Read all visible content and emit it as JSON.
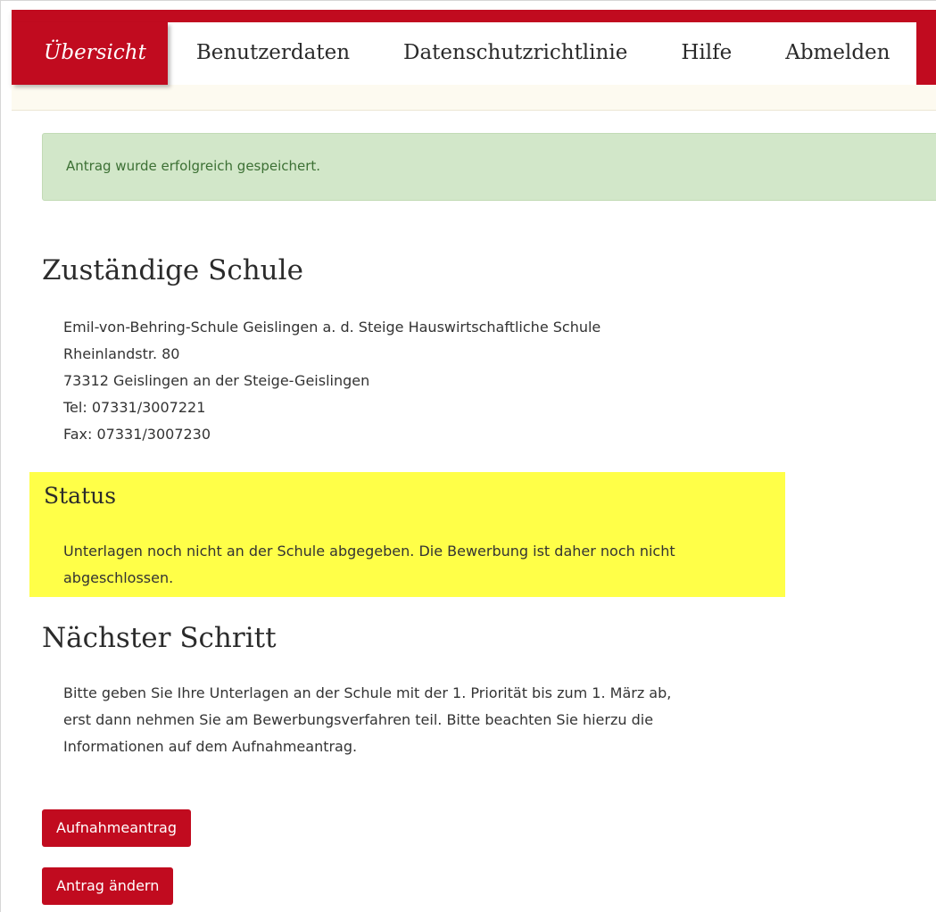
{
  "colors": {
    "brand_red": "#c10b1f",
    "success_bg": "#d2e7c9",
    "success_text": "#3c7034",
    "status_highlight": "#ffff48"
  },
  "nav": {
    "items": [
      {
        "label": "Übersicht",
        "active": true
      },
      {
        "label": "Benutzerdaten",
        "active": false
      },
      {
        "label": "Datenschutzrichtlinie",
        "active": false
      },
      {
        "label": "Hilfe",
        "active": false
      },
      {
        "label": "Abmelden",
        "active": false
      }
    ]
  },
  "alert": {
    "message": "Antrag wurde erfolgreich gespeichert."
  },
  "school": {
    "heading": "Zuständige Schule",
    "lines": [
      "Emil-von-Behring-Schule Geislingen a. d. Steige Hauswirtschaftliche Schule",
      "Rheinlandstr. 80",
      "73312 Geislingen an der Steige-Geislingen",
      "Tel: 07331/3007221",
      "Fax: 07331/3007230"
    ]
  },
  "status": {
    "heading": "Status",
    "text": "Unterlagen noch nicht an der Schule abgegeben. Die Bewerbung ist daher noch nicht abgeschlossen."
  },
  "next_step": {
    "heading": "Nächster Schritt",
    "lines": [
      "Bitte geben Sie Ihre Unterlagen an der Schule mit der 1. Priorität bis zum 1. März ab,",
      "erst dann nehmen Sie am Bewerbungsverfahren teil. Bitte beachten Sie hierzu die",
      "Informationen auf dem Aufnahmeantrag."
    ]
  },
  "buttons": {
    "application_form": "Aufnahmeantrag",
    "edit_application": "Antrag ändern"
  }
}
